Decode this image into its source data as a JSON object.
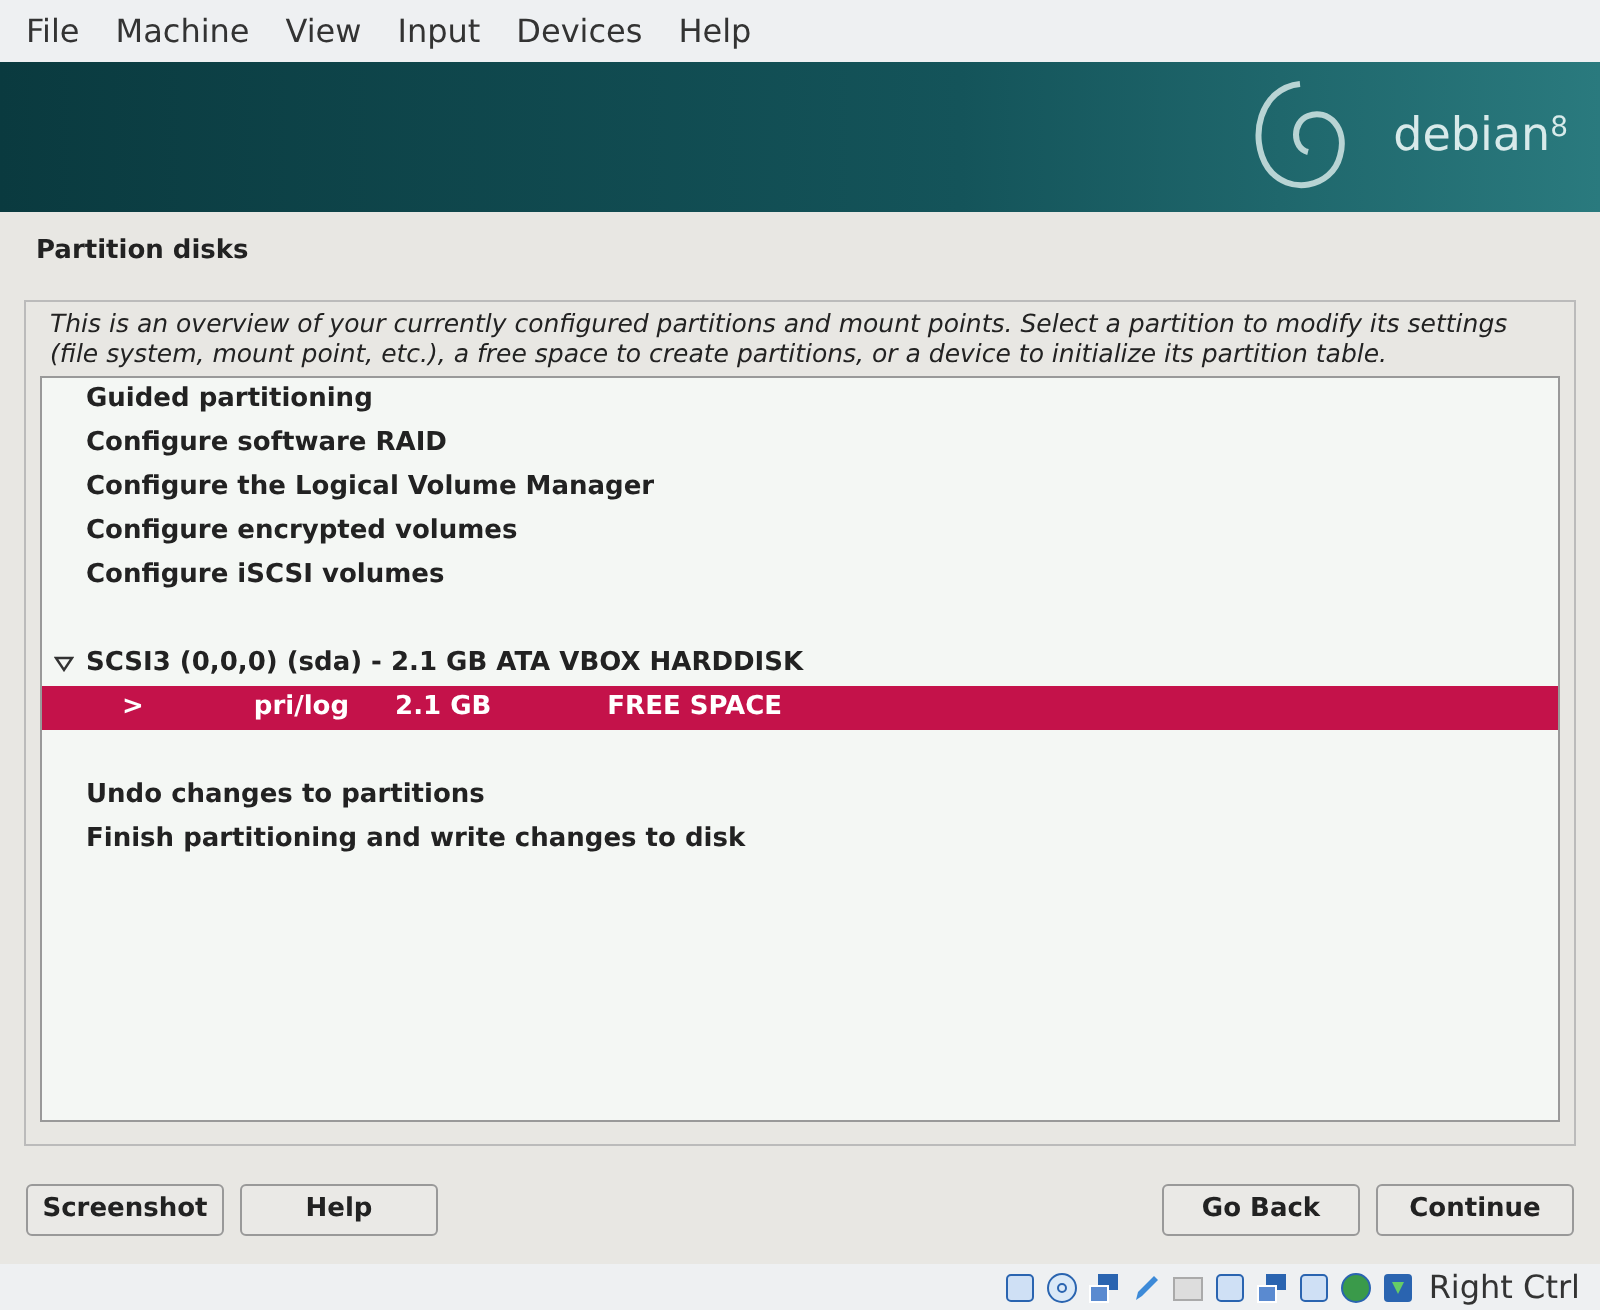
{
  "menu": [
    "File",
    "Machine",
    "View",
    "Input",
    "Devices",
    "Help"
  ],
  "banner": {
    "brand": "debian",
    "version": "8"
  },
  "title": "Partition disks",
  "description": "This is an overview of your currently configured partitions and mount points. Select a partition to modify its settings (file system, mount point, etc.), a free space to create partitions, or a device to initialize its partition table.",
  "items": [
    {
      "kind": "action",
      "label": "Guided partitioning",
      "selected": false
    },
    {
      "kind": "action",
      "label": "Configure software RAID",
      "selected": false
    },
    {
      "kind": "action",
      "label": "Configure the Logical Volume Manager",
      "selected": false
    },
    {
      "kind": "action",
      "label": "Configure encrypted volumes",
      "selected": false
    },
    {
      "kind": "action",
      "label": "Configure iSCSI volumes",
      "selected": false
    },
    {
      "kind": "spacer"
    },
    {
      "kind": "disk",
      "label": "SCSI3 (0,0,0) (sda) - 2.1 GB ATA VBOX HARDDISK",
      "expanded": true,
      "selected": false
    },
    {
      "kind": "partition",
      "marker": ">",
      "type": "pri/log",
      "size": "2.1 GB",
      "label": "FREE SPACE",
      "selected": true
    },
    {
      "kind": "spacer"
    },
    {
      "kind": "action",
      "label": "Undo changes to partitions",
      "selected": false
    },
    {
      "kind": "action",
      "label": "Finish partitioning and write changes to disk",
      "selected": false
    }
  ],
  "left_buttons": [
    "Screenshot",
    "Help"
  ],
  "right_buttons": [
    "Go Back",
    "Continue"
  ],
  "status_bar": {
    "host_key": "Right Ctrl"
  }
}
